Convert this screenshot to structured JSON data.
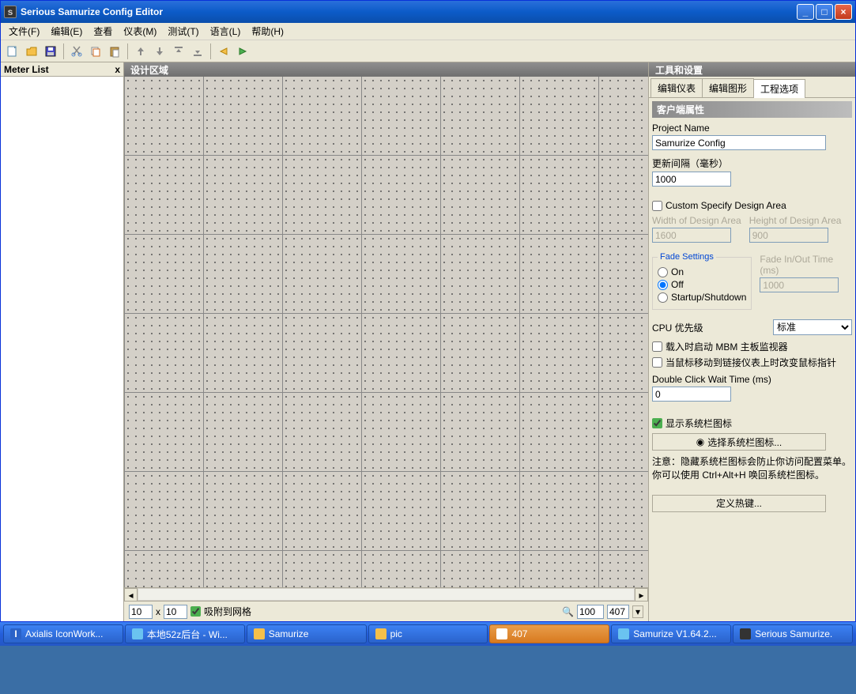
{
  "titlebar": {
    "title": "Serious Samurize Config Editor"
  },
  "menu": {
    "items": [
      "文件(F)",
      "编辑(E)",
      "查看",
      "仪表(M)",
      "测试(T)",
      "语言(L)",
      "帮助(H)"
    ]
  },
  "left_panel": {
    "title": "Meter List",
    "close": "x"
  },
  "design_area": {
    "title": "设计区域"
  },
  "bottom_bar": {
    "w": "10",
    "x": "x",
    "h": "10",
    "snap": "吸附到网格",
    "zoom": "100",
    "zoom2": "407"
  },
  "right_panel": {
    "title": "工具和设置",
    "tabs": [
      "编辑仪表",
      "编辑图形",
      "工程选项"
    ],
    "section": "客户端属性",
    "project_name_label": "Project Name",
    "project_name": "Samurize Config",
    "interval_label": "更新间隔（毫秒）",
    "interval": "1000",
    "custom_area": "Custom Specify Design Area",
    "width_label": "Width of Design Area",
    "width": "1600",
    "height_label": "Height of Design Area",
    "height": "900",
    "fade_legend": "Fade Settings",
    "fade_on": "On",
    "fade_off": "Off",
    "fade_ss": "Startup/Shutdown",
    "fade_time_label": "Fade In/Out Time (ms)",
    "fade_time": "1000",
    "cpu_label": "CPU 优先级",
    "cpu_value": "标准",
    "mbm": "载入时启动 MBM 主板监视器",
    "cursor": "当鼠标移动到链接仪表上时改变鼠标指针",
    "dblclick_label": "Double Click Wait Time (ms)",
    "dblclick": "0",
    "showtray": "显示系统栏图标",
    "choose_tray": "选择系统栏图标...",
    "note": "注意：隐藏系统栏图标会防止你访问配置菜单。你可以使用 Ctrl+Alt+H 唤回系统栏图标。",
    "hotkeys": "定义热键..."
  },
  "taskbar": {
    "items": [
      {
        "label": "Axialis IconWork...",
        "active": false
      },
      {
        "label": "本地52z后台 - Wi...",
        "active": false
      },
      {
        "label": "Samurize",
        "active": false
      },
      {
        "label": "pic",
        "active": false
      },
      {
        "label": "407",
        "active": true
      },
      {
        "label": "Samurize V1.64.2...",
        "active": false
      },
      {
        "label": "Serious Samurize.",
        "active": false
      }
    ]
  }
}
